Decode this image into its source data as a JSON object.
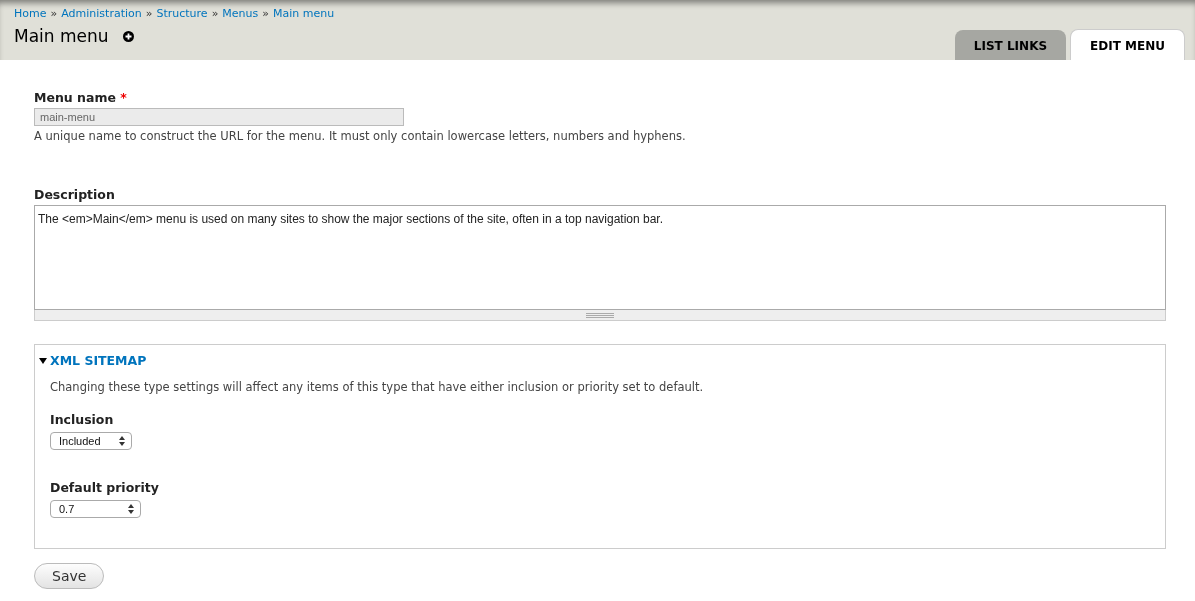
{
  "breadcrumb": {
    "separator": "»",
    "links": [
      "Home",
      "Administration",
      "Structure",
      "Menus",
      "Main menu"
    ]
  },
  "title": "Main menu",
  "tabs": [
    {
      "label": "LIST LINKS",
      "selected": false
    },
    {
      "label": "EDIT MENU",
      "selected": true
    }
  ],
  "menu_name": {
    "label": "Menu name",
    "required_mark": "*",
    "value": "main-menu",
    "disabled": true,
    "help": "A unique name to construct the URL for the menu. It must only contain lowercase letters, numbers and hyphens."
  },
  "description": {
    "label": "Description",
    "value": "The <em>Main</em> menu is used on many sites to show the major sections of the site, often in a top navigation bar."
  },
  "xml_sitemap": {
    "legend": "XML SITEMAP",
    "expanded": true,
    "help": "Changing these type settings will affect any items of this type that have either inclusion or priority set to default.",
    "fields": [
      {
        "label": "Inclusion",
        "value": "Included"
      },
      {
        "label": "Default priority",
        "value": "0.7"
      }
    ]
  },
  "save_button": "Save"
}
